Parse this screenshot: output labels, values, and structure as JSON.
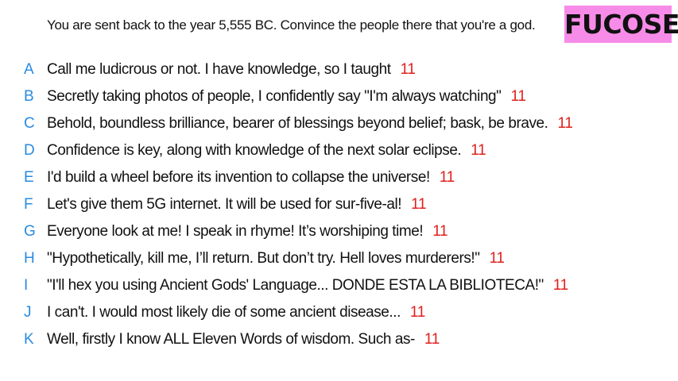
{
  "prompt": "You are sent back to the year 5,555 BC. Convince the people there that you're a god.",
  "player_name": "FUCOSE",
  "colors": {
    "letter": "#2a8be0",
    "score": "#e0201d",
    "badge_bg": "#f78ce8"
  },
  "answers": [
    {
      "letter": "A",
      "text": "Call me ludicrous or not. I have knowledge, so I taught",
      "score": "11"
    },
    {
      "letter": "B",
      "text": "Secretly taking photos of people, I confidently say \"I'm always watching\"",
      "score": "11"
    },
    {
      "letter": "C",
      "text": "Behold, boundless brilliance, bearer of blessings beyond belief; bask, be brave.",
      "score": "11"
    },
    {
      "letter": "D",
      "text": "Confidence is key, along with knowledge of the next solar eclipse.",
      "score": "11"
    },
    {
      "letter": "E",
      "text": "I'd build a wheel before its invention to collapse the universe!",
      "score": "11"
    },
    {
      "letter": "F",
      "text": "Let's give them 5G internet. It will be used for sur-five-al!",
      "score": "11"
    },
    {
      "letter": "G",
      "text": "Everyone look at me! I speak in rhyme! It’s worshiping time!",
      "score": "11"
    },
    {
      "letter": "H",
      "text": "\"Hypothetically, kill me, I’ll return. But don’t try. Hell loves murderers!\"",
      "score": "11"
    },
    {
      "letter": "I",
      "text": "\"I'll hex you using Ancient Gods' Language... DONDE ESTA LA BIBLIOTECA!\"",
      "score": "11"
    },
    {
      "letter": "J",
      "text": "I can't. I would most likely die of some ancient disease...",
      "score": "11"
    },
    {
      "letter": "K",
      "text": "Well, firstly I know ALL Eleven Words of wisdom. Such as-",
      "score": "11"
    }
  ]
}
